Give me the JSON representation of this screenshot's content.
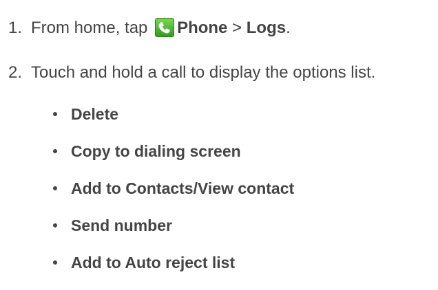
{
  "steps": [
    {
      "number": "1.",
      "text_before": "From home, tap ",
      "icon": "phone-app-icon",
      "bold_1": "Phone",
      "separator": " > ",
      "bold_2": "Logs",
      "text_after": "."
    },
    {
      "number": "2.",
      "text": "Touch and hold a call to display the options list."
    }
  ],
  "options": [
    "Delete",
    "Copy to dialing screen",
    "Add to Contacts/View contact",
    "Send number",
    "Add to Auto reject list"
  ],
  "colors": {
    "text": "#444444",
    "icon_green": "#5cb82e",
    "icon_dark_green": "#2f7d1a"
  }
}
